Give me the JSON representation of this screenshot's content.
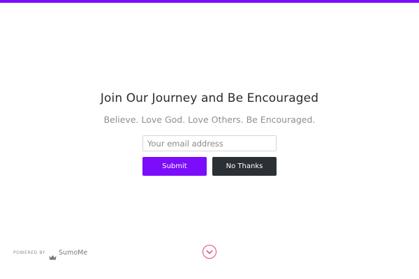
{
  "colors": {
    "accent": "#7b0dfb",
    "secondary_button": "#2b3035",
    "scroll_icon": "#e0457b"
  },
  "popup": {
    "headline": "Join Our Journey and Be Encouraged",
    "subhead": "Believe. Love God. Love Others. Be Encouraged.",
    "email_placeholder": "Your email address",
    "email_value": "",
    "submit_label": "Submit",
    "no_thanks_label": "No Thanks"
  },
  "footer": {
    "powered_by": "POWERED BY",
    "brand_icon": "crown-icon",
    "brand": "SumoMe"
  },
  "scroll": {
    "icon": "chevron-down-circle-icon"
  }
}
